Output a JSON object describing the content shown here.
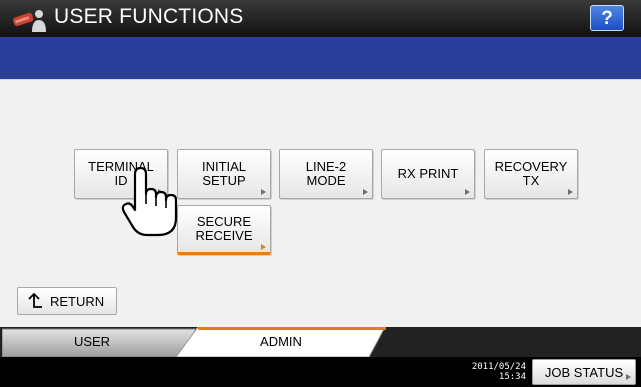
{
  "header": {
    "title": "USER FUNCTIONS",
    "help_label": "?",
    "app_icon": "toner-cartridge-user-icon"
  },
  "message": "",
  "functions": [
    {
      "label": "TERMINAL\nID",
      "selected": false
    },
    {
      "label": "INITIAL\nSETUP",
      "selected": false
    },
    {
      "label": "LINE-2\nMODE",
      "selected": false
    },
    {
      "label": "RX PRINT",
      "selected": false
    },
    {
      "label": "RECOVERY\nTX",
      "selected": false
    },
    {
      "label": "SECURE\nRECEIVE",
      "selected": true
    }
  ],
  "return_button": {
    "label": "RETURN",
    "icon": "return-arrow-icon"
  },
  "pointer": {
    "icon": "pointing-hand-icon"
  },
  "tabs": [
    {
      "label": "USER",
      "active": false
    },
    {
      "label": "ADMIN",
      "active": true
    }
  ],
  "status": {
    "date": "2011/05/24",
    "time": "15:34",
    "job_status_label": "JOB STATUS"
  },
  "colors": {
    "title_bar": "#1a1a1a",
    "message_bar": "#2a3f9a",
    "content_bg": "#f1f1f1",
    "accent_orange": "#e1801a",
    "help_button": "#2f62d6"
  }
}
